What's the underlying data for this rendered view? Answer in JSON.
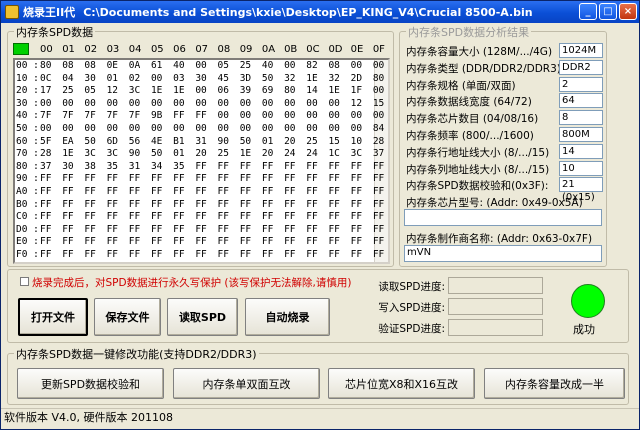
{
  "window": {
    "app_name": "烧录王II代",
    "file_path": "C:\\Documents and Settings\\kxie\\Desktop\\EP_KING_V4\\Crucial 8500-A.bin",
    "minimize": "_",
    "maximize": "□",
    "close": "×"
  },
  "spd": {
    "group_title": "内存条SPD数据",
    "status_color": "#00d000",
    "columns": [
      "00",
      "01",
      "02",
      "03",
      "04",
      "05",
      "06",
      "07",
      "08",
      "09",
      "0A",
      "0B",
      "0C",
      "0D",
      "0E",
      "0F"
    ],
    "rows": [
      {
        "addr": "00 :",
        "cells": [
          "80",
          "08",
          "08",
          "0E",
          "0A",
          "61",
          "40",
          "00",
          "05",
          "25",
          "40",
          "00",
          "82",
          "08",
          "00",
          "00"
        ]
      },
      {
        "addr": "10 :",
        "cells": [
          "0C",
          "04",
          "30",
          "01",
          "02",
          "00",
          "03",
          "30",
          "45",
          "3D",
          "50",
          "32",
          "1E",
          "32",
          "2D",
          "80"
        ]
      },
      {
        "addr": "20 :",
        "cells": [
          "17",
          "25",
          "05",
          "12",
          "3C",
          "1E",
          "1E",
          "00",
          "06",
          "39",
          "69",
          "80",
          "14",
          "1E",
          "1F",
          "00"
        ]
      },
      {
        "addr": "30 :",
        "cells": [
          "00",
          "00",
          "00",
          "00",
          "00",
          "00",
          "00",
          "00",
          "00",
          "00",
          "00",
          "00",
          "00",
          "00",
          "12",
          "15"
        ]
      },
      {
        "addr": "40 :",
        "cells": [
          "7F",
          "7F",
          "7F",
          "7F",
          "7F",
          "9B",
          "FF",
          "FF",
          "00",
          "00",
          "00",
          "00",
          "00",
          "00",
          "00",
          "00"
        ]
      },
      {
        "addr": "50 :",
        "cells": [
          "00",
          "00",
          "00",
          "00",
          "00",
          "00",
          "00",
          "00",
          "00",
          "00",
          "00",
          "00",
          "00",
          "00",
          "00",
          "84"
        ]
      },
      {
        "addr": "60 :",
        "cells": [
          "5F",
          "EA",
          "50",
          "6D",
          "56",
          "4E",
          "B1",
          "31",
          "90",
          "50",
          "01",
          "20",
          "25",
          "15",
          "10",
          "28"
        ]
      },
      {
        "addr": "70 :",
        "cells": [
          "28",
          "1E",
          "3C",
          "3C",
          "90",
          "50",
          "01",
          "20",
          "25",
          "1E",
          "20",
          "24",
          "24",
          "1C",
          "3C",
          "37"
        ]
      },
      {
        "addr": "80 :",
        "cells": [
          "37",
          "30",
          "38",
          "35",
          "31",
          "34",
          "35",
          "FF",
          "FF",
          "FF",
          "FF",
          "FF",
          "FF",
          "FF",
          "FF",
          "FF"
        ]
      },
      {
        "addr": "90 :",
        "cells": [
          "FF",
          "FF",
          "FF",
          "FF",
          "FF",
          "FF",
          "FF",
          "FF",
          "FF",
          "FF",
          "FF",
          "FF",
          "FF",
          "FF",
          "FF",
          "FF"
        ]
      },
      {
        "addr": "A0 :",
        "cells": [
          "FF",
          "FF",
          "FF",
          "FF",
          "FF",
          "FF",
          "FF",
          "FF",
          "FF",
          "FF",
          "FF",
          "FF",
          "FF",
          "FF",
          "FF",
          "FF"
        ]
      },
      {
        "addr": "B0 :",
        "cells": [
          "FF",
          "FF",
          "FF",
          "FF",
          "FF",
          "FF",
          "FF",
          "FF",
          "FF",
          "FF",
          "FF",
          "FF",
          "FF",
          "FF",
          "FF",
          "FF"
        ]
      },
      {
        "addr": "C0 :",
        "cells": [
          "FF",
          "FF",
          "FF",
          "FF",
          "FF",
          "FF",
          "FF",
          "FF",
          "FF",
          "FF",
          "FF",
          "FF",
          "FF",
          "FF",
          "FF",
          "FF"
        ]
      },
      {
        "addr": "D0 :",
        "cells": [
          "FF",
          "FF",
          "FF",
          "FF",
          "FF",
          "FF",
          "FF",
          "FF",
          "FF",
          "FF",
          "FF",
          "FF",
          "FF",
          "FF",
          "FF",
          "FF"
        ]
      },
      {
        "addr": "E0 :",
        "cells": [
          "FF",
          "FF",
          "FF",
          "FF",
          "FF",
          "FF",
          "FF",
          "FF",
          "FF",
          "FF",
          "FF",
          "FF",
          "FF",
          "FF",
          "FF",
          "FF"
        ]
      },
      {
        "addr": "F0 :",
        "cells": [
          "FF",
          "FF",
          "FF",
          "FF",
          "FF",
          "FF",
          "FF",
          "FF",
          "FF",
          "FF",
          "FF",
          "FF",
          "FF",
          "FF",
          "FF",
          "FF"
        ]
      }
    ]
  },
  "analysis": {
    "group_title": "内存条SPD数据分析结果",
    "items": [
      {
        "label": "内存条容量大小 (128M/.../4G)",
        "value": "1024M"
      },
      {
        "label": "内存条类型 (DDR/DDR2/DDR3)",
        "value": "DDR2"
      },
      {
        "label": "内存条规格 (单面/双面)",
        "value": "2"
      },
      {
        "label": "内存条数据线宽度 (64/72)",
        "value": "64"
      },
      {
        "label": "内存条芯片数目 (04/08/16)",
        "value": "8"
      },
      {
        "label": "内存条频率 (800/.../1600)",
        "value": "800M"
      },
      {
        "label": "内存条行地址线大小 (8/.../15)",
        "value": "14"
      },
      {
        "label": "内存条列地址线大小 (8/.../15)",
        "value": "10"
      },
      {
        "label": "内存条SPD数据校验和(0x3F):",
        "value": "21 (0x15)"
      }
    ],
    "chip_model_label": "内存条芯片型号: (Addr: 0x49-0x5A)",
    "chip_model_value": "",
    "manufacturer_label": "内存条制作商名称: (Addr: 0x63-0x7F)",
    "manufacturer_value": "mVN"
  },
  "controls": {
    "write_protect_text": "烧录完成后，对SPD数据进行永久写保护 (该写保护无法解除,请慎用)",
    "open_file": "打开文件",
    "save_file": "保存文件",
    "read_spd": "读取SPD",
    "auto_burn": "自动烧录",
    "read_progress_label": "读取SPD进度:",
    "read_progress": 0,
    "write_progress_label": "写入SPD进度:",
    "write_progress": 0,
    "verify_progress_label": "验证SPD进度:",
    "verify_progress": 0,
    "status_text": "成功",
    "status_color": "#00ff00"
  },
  "quick_modify": {
    "group_title": "内存条SPD数据一键修改功能(支持DDR2/DDR3)",
    "update_checksum": "更新SPD数据校验和",
    "swap_sides": "内存条单双面互改",
    "swap_width": "芯片位宽X8和X16互改",
    "halve_capacity": "内存条容量改成一半"
  },
  "statusbar": {
    "text": "软件版本 V4.0, 硬件版本 201108"
  }
}
